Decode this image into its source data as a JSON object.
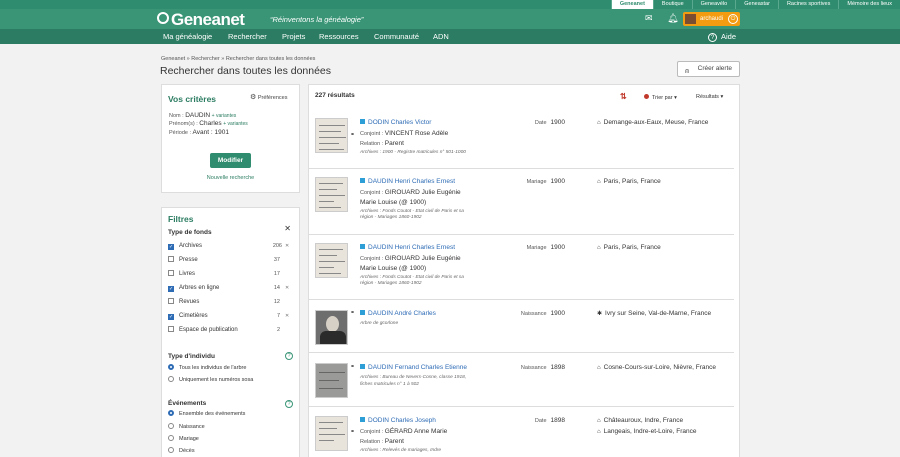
{
  "top_tabs": [
    "Geneanet",
    "Boutique",
    "Geneavélo",
    "Geneastar",
    "Racines sportives",
    "Mémoire des lieux"
  ],
  "header": {
    "logo": "Geneanet",
    "tagline": "“Réinventons la généalogie”",
    "username": "archaudi"
  },
  "nav": {
    "items": [
      "Ma généalogie",
      "Rechercher",
      "Projets",
      "Ressources",
      "Communauté",
      "ADN"
    ],
    "help": "Aide"
  },
  "breadcrumb": "Geneanet » Rechercher » Rechercher dans toutes les données",
  "page_title": "Rechercher dans toutes les données",
  "alert_button": "Créer alerte",
  "criteria": {
    "title": "Vos critères",
    "preferences": "Préférences",
    "nom_label": "Nom :",
    "nom": "DAUDIN",
    "nom_variants": "+ variantes",
    "prenom_label": "Prénom(s) :",
    "prenom": "Charles",
    "prenom_variants": "+ variantes",
    "periode_label": "Période :",
    "periode": "Avant : 1901",
    "modify": "Modifier",
    "new_search": "Nouvelle recherche"
  },
  "filters": {
    "title": "Filtres",
    "fonds_title": "Type de fonds",
    "fonds": [
      {
        "label": "Archives",
        "count": "206",
        "checked": true
      },
      {
        "label": "Presse",
        "count": "37",
        "checked": false
      },
      {
        "label": "Livres",
        "count": "17",
        "checked": false
      },
      {
        "label": "Arbres en ligne",
        "count": "14",
        "checked": true
      },
      {
        "label": "Revues",
        "count": "12",
        "checked": false
      },
      {
        "label": "Cimetières",
        "count": "7",
        "checked": true
      },
      {
        "label": "Espace de publication",
        "count": "2",
        "checked": false
      }
    ],
    "individu_title": "Type d'individu",
    "individu": [
      {
        "label": "Tous les individus de l'arbre",
        "selected": true
      },
      {
        "label": "Uniquement les numéros sosa",
        "selected": false
      }
    ],
    "events_title": "Événements",
    "events": [
      {
        "label": "Ensemble des événements",
        "selected": true
      },
      {
        "label": "Naissance",
        "selected": false
      },
      {
        "label": "Mariage",
        "selected": false
      },
      {
        "label": "Décès",
        "selected": false
      }
    ]
  },
  "results": {
    "count": "227 résultats",
    "sort": "Trier par",
    "results_menu": "Résultats",
    "items": [
      {
        "name": "DODIN Charles Victor",
        "l1k": "Conjoint :",
        "l1v": "VINCENT Rose Adèle",
        "l2k": "Relation :",
        "l2v": "Parent",
        "src": "Archives : 1900 - Registre matricules n° 501-1000",
        "ev": "Date",
        "yr": "1900",
        "pl": "Demange-aux-Eaux, Meuse, France"
      },
      {
        "name": "DAUDIN Henri Charles Ernest",
        "l1k": "Conjoint :",
        "l1v": "GIROUARD Julie Eugénie",
        "l2k": "",
        "l2v": "Marie Louise (@ 1900)",
        "src": "Archives : Fonds Coutot - Etat civil de Paris et sa",
        "src2": "région - Mariages 1860-1902",
        "ev": "Mariage",
        "yr": "1900",
        "pl": "Paris, Paris, France"
      },
      {
        "name": "DAUDIN Henri Charles Ernest",
        "l1k": "Conjoint :",
        "l1v": "GIROUARD Julie Eugénie",
        "l2k": "",
        "l2v": "Marie Louise (@ 1900)",
        "src": "Archives : Fonds Coutot - Etat civil de Paris et sa",
        "src2": "région - Mariages 1860-1902",
        "ev": "Mariage",
        "yr": "1900",
        "pl": "Paris, Paris, France"
      },
      {
        "name": "DAUDIN André Charles",
        "src": "Arbre de gcorlone",
        "ev": "Naissance",
        "yr": "1900",
        "pl": "Ivry sur Seine, Val-de-Marne, France"
      },
      {
        "name": "DAUDIN Fernand Charles Etienne",
        "src": "Archives : Bureau de Nevers-Cosne, classe 1918,",
        "src2": "fiches matricules n° 1 à 502",
        "ev": "Naissance",
        "yr": "1898",
        "pl": "Cosne-Cours-sur-Loire, Nièvre, France"
      },
      {
        "name": "DODIN Charles Joseph",
        "l1k": "Conjoint :",
        "l1v": "GÉRARD Anne Marie",
        "l2k": "Relation :",
        "l2v": "Parent",
        "src": "Archives : Relevés de mariages, Indre",
        "ev": "Date",
        "yr": "1898",
        "pl": "Châteauroux, Indre, France",
        "pl2": "Langeais, Indre-et-Loire, France"
      }
    ]
  },
  "colors": {
    "brand": "#3a9577",
    "nav": "#2b7c62",
    "link": "#2d6bb5",
    "accent": "#f39c12"
  }
}
